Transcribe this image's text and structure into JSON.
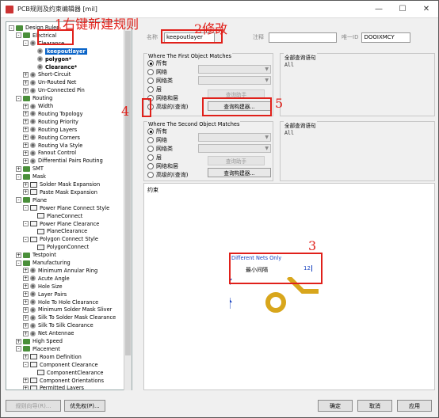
{
  "window": {
    "title": "PCB规则及约束编辑器 [mil]",
    "controls": [
      "—",
      "☐",
      "✕"
    ]
  },
  "tree": {
    "items": [
      {
        "label": "Design Rules",
        "level": 0,
        "exp": "-",
        "icon": "folder",
        "bold": false
      },
      {
        "label": "Electrical",
        "level": 1,
        "exp": "-",
        "icon": "folder",
        "bold": false
      },
      {
        "label": "Clearance",
        "level": 2,
        "exp": "-",
        "icon": "gear",
        "bold": false
      },
      {
        "label": "keepoutlayer",
        "level": 3,
        "exp": "",
        "icon": "gear",
        "bold": true,
        "selected": true
      },
      {
        "label": "polygon*",
        "level": 3,
        "exp": "",
        "icon": "gear",
        "bold": true
      },
      {
        "label": "Clearance*",
        "level": 3,
        "exp": "",
        "icon": "gear",
        "bold": true
      },
      {
        "label": "Short-Circuit",
        "level": 2,
        "exp": "+",
        "icon": "gear",
        "bold": false
      },
      {
        "label": "Un-Routed Net",
        "level": 2,
        "exp": "+",
        "icon": "gear",
        "bold": false
      },
      {
        "label": "Un-Connected Pin",
        "level": 2,
        "exp": "+",
        "icon": "gear",
        "bold": false
      },
      {
        "label": "Routing",
        "level": 1,
        "exp": "-",
        "icon": "folder",
        "bold": false
      },
      {
        "label": "Width",
        "level": 2,
        "exp": "+",
        "icon": "gear",
        "bold": false
      },
      {
        "label": "Routing Topology",
        "level": 2,
        "exp": "+",
        "icon": "gear",
        "bold": false
      },
      {
        "label": "Routing Priority",
        "level": 2,
        "exp": "+",
        "icon": "gear",
        "bold": false
      },
      {
        "label": "Routing Layers",
        "level": 2,
        "exp": "+",
        "icon": "gear",
        "bold": false
      },
      {
        "label": "Routing Corners",
        "level": 2,
        "exp": "+",
        "icon": "gear",
        "bold": false
      },
      {
        "label": "Routing Via Style",
        "level": 2,
        "exp": "+",
        "icon": "gear",
        "bold": false
      },
      {
        "label": "Fanout Control",
        "level": 2,
        "exp": "+",
        "icon": "gear",
        "bold": false
      },
      {
        "label": "Differential Pairs Routing",
        "level": 2,
        "exp": "+",
        "icon": "gear",
        "bold": false
      },
      {
        "label": "SMT",
        "level": 1,
        "exp": "+",
        "icon": "folder",
        "bold": false
      },
      {
        "label": "Mask",
        "level": 1,
        "exp": "-",
        "icon": "folder",
        "bold": false
      },
      {
        "label": "Solder Mask Expansion",
        "level": 2,
        "exp": "+",
        "icon": "rule",
        "bold": false
      },
      {
        "label": "Paste Mask Expansion",
        "level": 2,
        "exp": "+",
        "icon": "rule",
        "bold": false
      },
      {
        "label": "Plane",
        "level": 1,
        "exp": "-",
        "icon": "folder",
        "bold": false
      },
      {
        "label": "Power Plane Connect Style",
        "level": 2,
        "exp": "-",
        "icon": "rule",
        "bold": false
      },
      {
        "label": "PlaneConnect",
        "level": 3,
        "exp": "",
        "icon": "rule",
        "bold": false
      },
      {
        "label": "Power Plane Clearance",
        "level": 2,
        "exp": "-",
        "icon": "rule",
        "bold": false
      },
      {
        "label": "PlaneClearance",
        "level": 3,
        "exp": "",
        "icon": "rule",
        "bold": false
      },
      {
        "label": "Polygon Connect Style",
        "level": 2,
        "exp": "-",
        "icon": "rule",
        "bold": false
      },
      {
        "label": "PolygonConnect",
        "level": 3,
        "exp": "",
        "icon": "rule",
        "bold": false
      },
      {
        "label": "Testpoint",
        "level": 1,
        "exp": "+",
        "icon": "folder",
        "bold": false
      },
      {
        "label": "Manufacturing",
        "level": 1,
        "exp": "-",
        "icon": "folder",
        "bold": false
      },
      {
        "label": "Minimum Annular Ring",
        "level": 2,
        "exp": "+",
        "icon": "gear",
        "bold": false
      },
      {
        "label": "Acute Angle",
        "level": 2,
        "exp": "+",
        "icon": "gear",
        "bold": false
      },
      {
        "label": "Hole Size",
        "level": 2,
        "exp": "+",
        "icon": "gear",
        "bold": false
      },
      {
        "label": "Layer Pairs",
        "level": 2,
        "exp": "+",
        "icon": "gear",
        "bold": false
      },
      {
        "label": "Hole To Hole Clearance",
        "level": 2,
        "exp": "+",
        "icon": "gear",
        "bold": false
      },
      {
        "label": "Minimum Solder Mask Sliver",
        "level": 2,
        "exp": "+",
        "icon": "gear",
        "bold": false
      },
      {
        "label": "Silk To Solder Mask Clearance",
        "level": 2,
        "exp": "+",
        "icon": "gear",
        "bold": false
      },
      {
        "label": "Silk To Silk Clearance",
        "level": 2,
        "exp": "+",
        "icon": "gear",
        "bold": false
      },
      {
        "label": "Net Antennae",
        "level": 2,
        "exp": "+",
        "icon": "gear",
        "bold": false
      },
      {
        "label": "High Speed",
        "level": 1,
        "exp": "+",
        "icon": "folder",
        "bold": false
      },
      {
        "label": "Placement",
        "level": 1,
        "exp": "-",
        "icon": "folder",
        "bold": false
      },
      {
        "label": "Room Definition",
        "level": 2,
        "exp": "+",
        "icon": "rule",
        "bold": false
      },
      {
        "label": "Component Clearance",
        "level": 2,
        "exp": "-",
        "icon": "rule",
        "bold": false
      },
      {
        "label": "ComponentClearance",
        "level": 3,
        "exp": "",
        "icon": "rule",
        "bold": false
      },
      {
        "label": "Component Orientations",
        "level": 2,
        "exp": "+",
        "icon": "rule",
        "bold": false
      },
      {
        "label": "Permitted Layers",
        "level": 2,
        "exp": "+",
        "icon": "rule",
        "bold": false
      }
    ]
  },
  "form": {
    "name_label": "名称",
    "name_value": "keepoutlayer",
    "comment_label": "注释",
    "comment_value": "",
    "uid_label": "唯一ID",
    "uid_value": "DOOIXMCY"
  },
  "first_match": {
    "title": "Where The First Object Matches",
    "options": [
      "所有",
      "网络",
      "网络类",
      "层",
      "网络和层",
      "高级的(查询)"
    ],
    "selected": 0,
    "helper_button": "查询助手",
    "builder_button": "查询构建器..."
  },
  "second_match": {
    "title": "Where The Second Object Matches",
    "options": [
      "所有",
      "网络",
      "网络类",
      "层",
      "网络和层",
      "高级的(查询)"
    ],
    "selected": 0,
    "helper_button": "查询助手",
    "builder_button": "查询构建器..."
  },
  "query1": {
    "title": "全部查询语句",
    "text": "All"
  },
  "query2": {
    "title": "全部查询语句",
    "text": "All"
  },
  "constraints": {
    "title": "约束",
    "net_scope": "Different Nets Only",
    "min_clearance_label": "最小间隔",
    "min_clearance_value": "12"
  },
  "annotations": {
    "a1": "1右键新建规则",
    "a2": "2修改",
    "a3": "3",
    "a4": "4",
    "a5": "5"
  },
  "buttons": {
    "rule_wizard": "规则向导(R)...",
    "priorities": "优先权(P)...",
    "ok": "确定",
    "cancel": "取消",
    "apply": "应用"
  },
  "colors": {
    "annotation": "#e0201a",
    "selection": "#0a64c8",
    "track": "#d8a61c"
  }
}
